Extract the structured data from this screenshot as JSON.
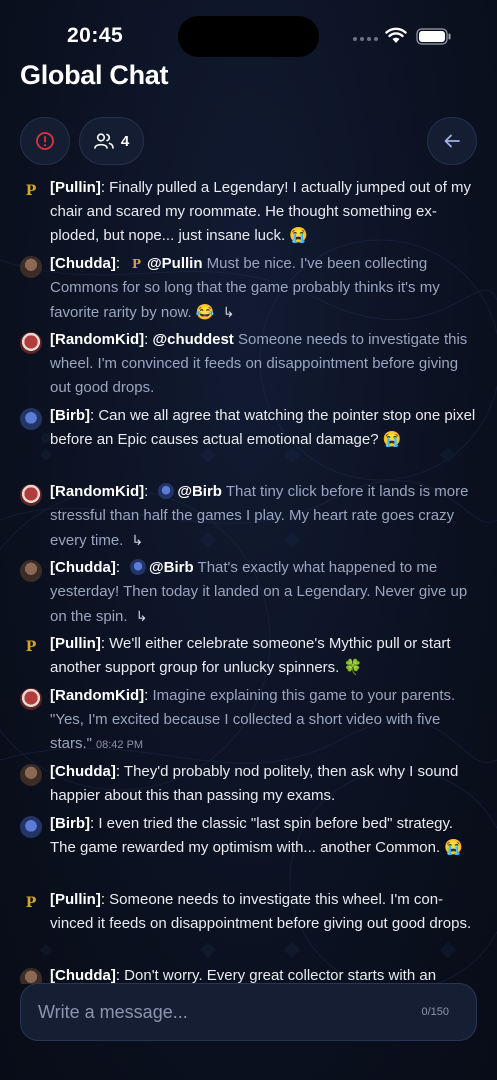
{
  "status_bar": {
    "time": "20:45"
  },
  "header": {
    "title": "Global Chat",
    "online_count": "4",
    "icons": {
      "report": "alert-circle-icon",
      "users": "users-icon",
      "back": "arrow-left-icon"
    }
  },
  "colors": {
    "background": "#0b1120",
    "panel": "#151d33",
    "accent_red": "#e0323c",
    "muted_text": "#9aa5bf"
  },
  "messages": [
    {
      "user": "[Pullin]",
      "avatar": "pullin",
      "parts": [
        "Finally pulled a Legendary! I actually jumped out of my chair and scared my roommate. He thought something ex-ploded, but nope... just insane luck.",
        "😭"
      ]
    },
    {
      "user": "[Chudda]",
      "avatar": "chudda",
      "mention": "@Pullin",
      "body": "Must be nice. I've been collecting Commons for so long that the game probably thinks it's my favorite rarity by now.",
      "emoji": "😂"
    },
    {
      "user": "[RandomKid]",
      "avatar": "random",
      "mention": "@chuddest",
      "body": "Someone needs to investigate this wheel. I'm convinced it feeds on disappointment before giving out good drops."
    },
    {
      "user": "[Birb]",
      "avatar": "birb",
      "body": "Can we all agree that watching the pointer stop one pixel before an Epic causes actual emotional damage?",
      "emoji": "😭"
    },
    {
      "user": "[RandomKid]",
      "avatar": "random",
      "mention": "@Birb",
      "body": "That tiny click before it lands is more stressful than half the games I play. My heart rate goes crazy every time."
    },
    {
      "user": "[Chudda]",
      "avatar": "chudda",
      "mention": "@Birb",
      "body": "That's exactly what happened to me yesterday! Then today it landed on a Legendary. Never give up on the spin."
    },
    {
      "user": "[Pullin]",
      "avatar": "pullin",
      "body": "We'll either celebrate someone's Mythic pull or start another support group for unlucky spinners.",
      "emoji": "🍀"
    },
    {
      "user": "[RandomKid]",
      "avatar": "random",
      "body": "Imagine explaining this game to your parents. \"Yes, I'm excited because I collected a short video with five stars.\"",
      "time": "08:42 PM"
    },
    {
      "user": "[Chudda]",
      "avatar": "chudda",
      "body": "They'd probably nod politely, then ask why I sound happier about this than passing my exams."
    },
    {
      "user": "[Birb]",
      "avatar": "birb",
      "body": "I even tried the classic \"last spin before bed\" strategy. The game rewarded my optimism with... another Common.",
      "emoji": "😭"
    },
    {
      "user": "[Pullin]",
      "avatar": "pullin",
      "body": "Someone needs to investigate this wheel. I'm con-vinced it feeds on disappointment before giving out good drops."
    },
    {
      "user": "[Chudda]",
      "avatar": "chudda",
      "body": "Don't worry. Every great collector starts with an"
    }
  ],
  "input": {
    "placeholder": "Write a message...",
    "char_count": "0/150"
  }
}
